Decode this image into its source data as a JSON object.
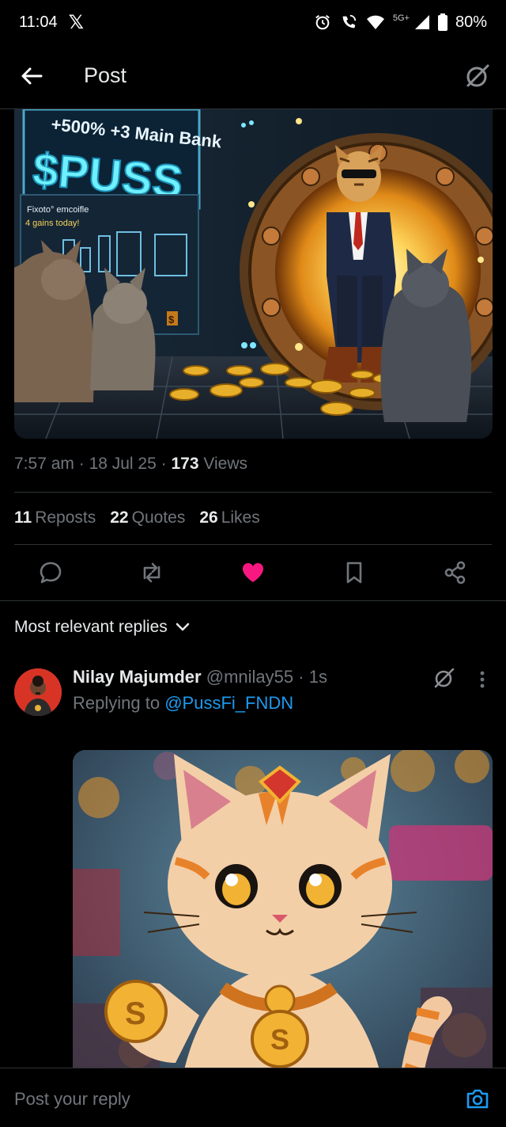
{
  "status_bar": {
    "time": "11:04",
    "app_icon": "x-logo-icon",
    "network": "5G+",
    "battery": "80%"
  },
  "header": {
    "title": "Post"
  },
  "post": {
    "time": "7:57 am",
    "date": "18 Jul 25",
    "views_count": "173",
    "views_label": "Views",
    "image_text": {
      "banner": "+500% +3 Main Bank",
      "brand": "$PUSS",
      "sub1": "Fixoto° emcoifle",
      "sub2": "4 gains today!",
      "tag": "$"
    },
    "stats": {
      "reposts_count": "11",
      "reposts_label": "Reposts",
      "quotes_count": "22",
      "quotes_label": "Quotes",
      "likes_count": "26",
      "likes_label": "Likes"
    },
    "like_color": "#f91880"
  },
  "replies": {
    "sort_label": "Most relevant replies",
    "items": [
      {
        "name": "Nilay Majumder",
        "handle": "@mnilay55",
        "time": "1s",
        "replying_prefix": "Replying to",
        "replying_to": "@PussFi_FNDN"
      }
    ]
  },
  "composer": {
    "placeholder": "Post your reply"
  },
  "colors": {
    "background": "#000000",
    "text": "#e7e9ea",
    "muted": "#71767b",
    "link": "#1d9bf0",
    "divider": "#2f3336"
  }
}
